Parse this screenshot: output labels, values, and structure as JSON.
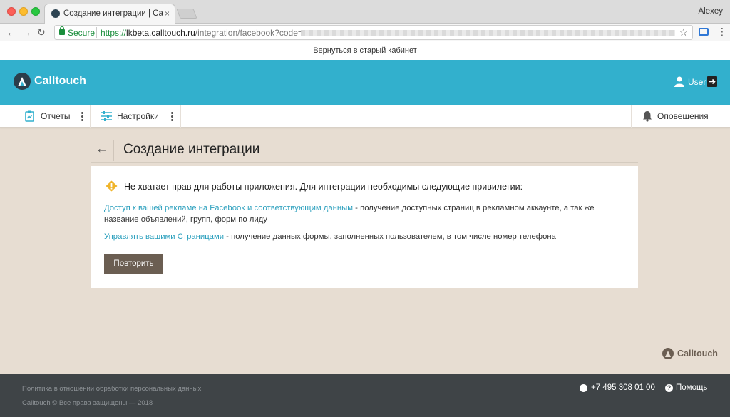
{
  "browser": {
    "tab_title": "Создание интеграции | Calltouch",
    "tab_close": "×",
    "profile_name": "Alexey",
    "address": {
      "secure_label": "Secure",
      "url_scheme": "https://",
      "url_host": "lkbeta.calltouch.ru",
      "url_path": "/integration/facebook?code="
    },
    "icons": {
      "back": "←",
      "forward": "→",
      "reload": "↻",
      "star": "☆",
      "menu": "⋮"
    }
  },
  "site": {
    "old_cabinet_link": "Вернуться в старый кабинет",
    "brand": "Calltouch",
    "brand_color": "#32b0cd",
    "user_label": "User",
    "nav": {
      "reports": "Отчеты",
      "settings": "Настройки",
      "notifications": "Оповещения"
    },
    "page": {
      "back_arrow": "←",
      "title": "Создание интеграции",
      "warning": "Не хватает прав для работы приложения. Для интеграции необходимы следующие привилегии:",
      "permissions": [
        {
          "link": "Доступ к вашей рекламе на Facebook и соответствующим данным",
          "desc": " - получение доступных страниц в рекламном аккаунте, а так же название объявлений, групп, форм по лиду"
        },
        {
          "link": "Управлять вашими Страницами",
          "desc": " - получение данных формы, заполненных пользователем, в том числе номер телефона"
        }
      ],
      "retry_button": "Повторить"
    },
    "footer": {
      "brand": "Calltouch",
      "policy_link": "Политика в отношении обработки персональных данных",
      "copyright": "Calltouch © Все права защищены — 2018",
      "phone": "+7 495 308 01 00",
      "help": "Помощь",
      "help_icon_glyph": "?"
    }
  }
}
